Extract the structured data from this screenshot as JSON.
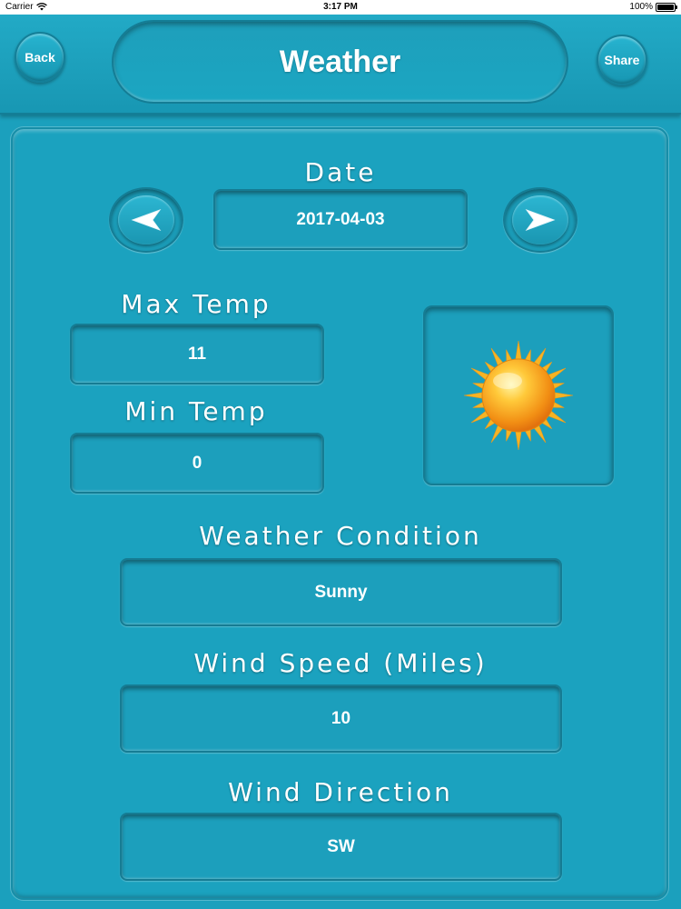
{
  "status_bar": {
    "carrier": "Carrier",
    "time": "3:17 PM",
    "battery": "100%"
  },
  "header": {
    "back_label": "Back",
    "title": "Weather",
    "share_label": "Share"
  },
  "date": {
    "label": "Date",
    "value": "2017-04-03",
    "prev_icon": "arrow-left-icon",
    "next_icon": "arrow-right-icon"
  },
  "max_temp": {
    "label": "Max Temp",
    "value": "11"
  },
  "min_temp": {
    "label": "Min Temp",
    "value": "0"
  },
  "condition_icon": "sun-icon",
  "condition": {
    "label": "Weather Condition",
    "value": "Sunny"
  },
  "wind_speed": {
    "label": "Wind Speed (Miles)",
    "value": "10"
  },
  "wind_direction": {
    "label": "Wind Direction",
    "value": "SW"
  },
  "colors": {
    "background": "#1ba0bd",
    "sun_core": "#f7a21b",
    "sun_rays": "#f5b623"
  }
}
